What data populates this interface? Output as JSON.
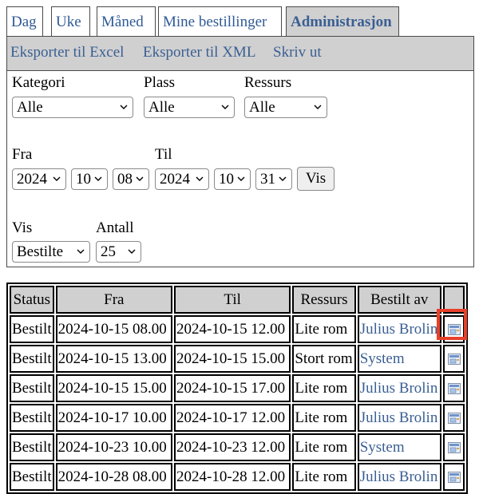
{
  "tabs": [
    {
      "label": "Dag"
    },
    {
      "label": "Uke"
    },
    {
      "label": "Måned"
    },
    {
      "label": "Mine bestillinger"
    },
    {
      "label": "Administrasjon",
      "active": true
    }
  ],
  "actions": {
    "export_excel": "Eksporter til Excel",
    "export_xml": "Eksporter til XML",
    "print": "Skriv ut"
  },
  "filters": {
    "kategori": {
      "label": "Kategori",
      "value": "Alle"
    },
    "plass": {
      "label": "Plass",
      "value": "Alle"
    },
    "ressurs": {
      "label": "Ressurs",
      "value": "Alle"
    },
    "fra": {
      "label": "Fra",
      "year": "2024",
      "month": "10",
      "day": "08"
    },
    "til": {
      "label": "Til",
      "year": "2024",
      "month": "10",
      "day": "31"
    },
    "vis_button": "Vis",
    "vis": {
      "label": "Vis",
      "value": "Bestilte"
    },
    "antall": {
      "label": "Antall",
      "value": "25"
    }
  },
  "table": {
    "headers": [
      "Status",
      "Fra",
      "Til",
      "Ressurs",
      "Bestilt av",
      ""
    ],
    "rows": [
      {
        "status": "Bestilt",
        "fra": "2024-10-15 08.00",
        "til": "2024-10-15 12.00",
        "ressurs": "Lite rom",
        "bestilt_av": "Julius Brolin"
      },
      {
        "status": "Bestilt",
        "fra": "2024-10-15 13.00",
        "til": "2024-10-15 15.00",
        "ressurs": "Stort rom",
        "bestilt_av": "System"
      },
      {
        "status": "Bestilt",
        "fra": "2024-10-15 15.00",
        "til": "2024-10-15 17.00",
        "ressurs": "Lite rom",
        "bestilt_av": "Julius Brolin"
      },
      {
        "status": "Bestilt",
        "fra": "2024-10-17 10.00",
        "til": "2024-10-17 12.00",
        "ressurs": "Lite rom",
        "bestilt_av": "Julius Brolin"
      },
      {
        "status": "Bestilt",
        "fra": "2024-10-23 10.00",
        "til": "2024-10-23 12.00",
        "ressurs": "Lite rom",
        "bestilt_av": "System"
      },
      {
        "status": "Bestilt",
        "fra": "2024-10-28 08.00",
        "til": "2024-10-28 12.00",
        "ressurs": "Lite rom",
        "bestilt_av": "Julius Brolin"
      }
    ],
    "row_icon": "details-icon"
  },
  "colors": {
    "link": "#3a5f93",
    "header_bg": "#d0d0d0",
    "highlight": "#e8402a"
  }
}
